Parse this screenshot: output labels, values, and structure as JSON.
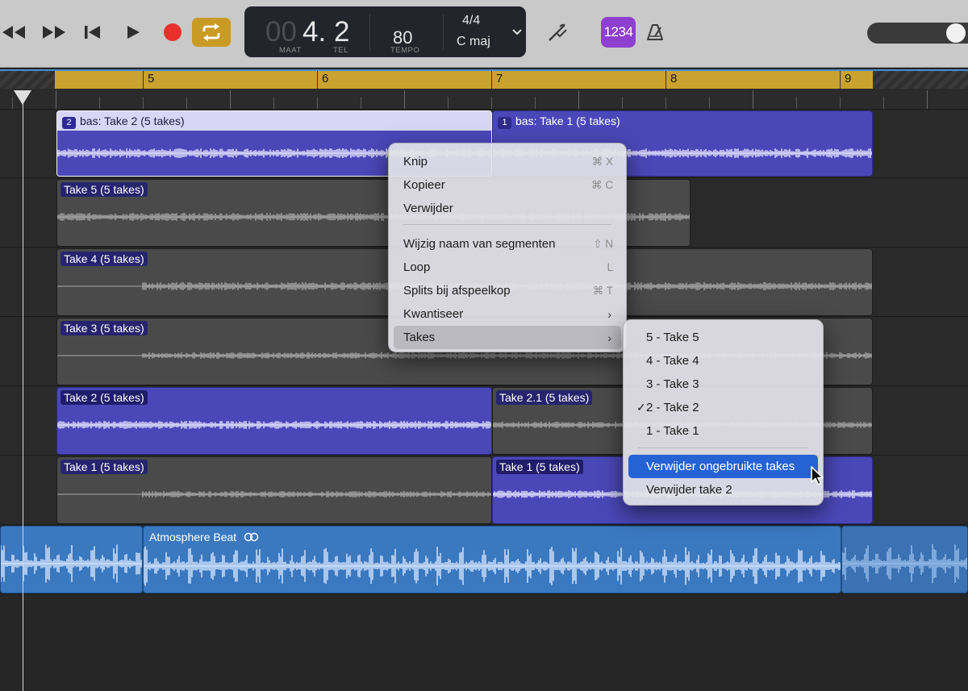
{
  "toolbar": {
    "lcd": {
      "bar_dim": "00",
      "bar_value": "4.",
      "beat_value": "2",
      "bar_caption": "MAAT",
      "beat_caption": "TEL",
      "tempo_value": "80",
      "tempo_caption": "TEMPO",
      "signature": "4/4",
      "key": "C maj"
    },
    "count_in_label": "1234"
  },
  "ruler": {
    "bars": [
      "5",
      "6",
      "7",
      "8",
      "9"
    ]
  },
  "tracks": {
    "bass_main": {
      "left_num": "2",
      "left_label": "bas: Take 2 (5 takes)",
      "right_num": "1",
      "right_label": "bas: Take 1 (5 takes)"
    },
    "take5": "Take 5 (5 takes)",
    "take4": "Take 4 (5 takes)",
    "take3": "Take 3 (5 takes)",
    "take2": "Take 2 (5 takes)",
    "take2_1": "Take 2.1 (5 takes)",
    "take1_left": "Take 1 (5 takes)",
    "take1_right": "Take 1 (5 takes)",
    "beat_label": "Atmosphere Beat"
  },
  "context_menu": {
    "items": [
      {
        "label": "Knip",
        "shortcut": "⌘ X"
      },
      {
        "label": "Kopieer",
        "shortcut": "⌘ C"
      },
      {
        "label": "Verwijder",
        "shortcut": ""
      },
      {
        "label": "Wijzig naam van segmenten",
        "shortcut": "⇧ N"
      },
      {
        "label": "Loop",
        "shortcut": "L"
      },
      {
        "label": "Splits bij afspeelkop",
        "shortcut": "⌘ T"
      },
      {
        "label": "Kwantiseer",
        "shortcut": ""
      },
      {
        "label": "Takes",
        "shortcut": ""
      }
    ]
  },
  "takes_submenu": {
    "items": [
      {
        "label": "5 - Take 5"
      },
      {
        "label": "4 - Take 4"
      },
      {
        "label": "3 - Take 3"
      },
      {
        "label": "2 - Take 2",
        "checked": true
      },
      {
        "label": "1 - Take 1"
      },
      {
        "label": "Verwijder ongebruikte takes"
      },
      {
        "label": "Verwijder take 2"
      }
    ],
    "check_mark": "✓"
  },
  "colors": {
    "take_purple": "#4a48b8",
    "cycle_yellow": "#c9a22f",
    "beat_blue": "#3a78c0",
    "record_red": "#e8312b",
    "highlight_blue": "#2563d4"
  }
}
